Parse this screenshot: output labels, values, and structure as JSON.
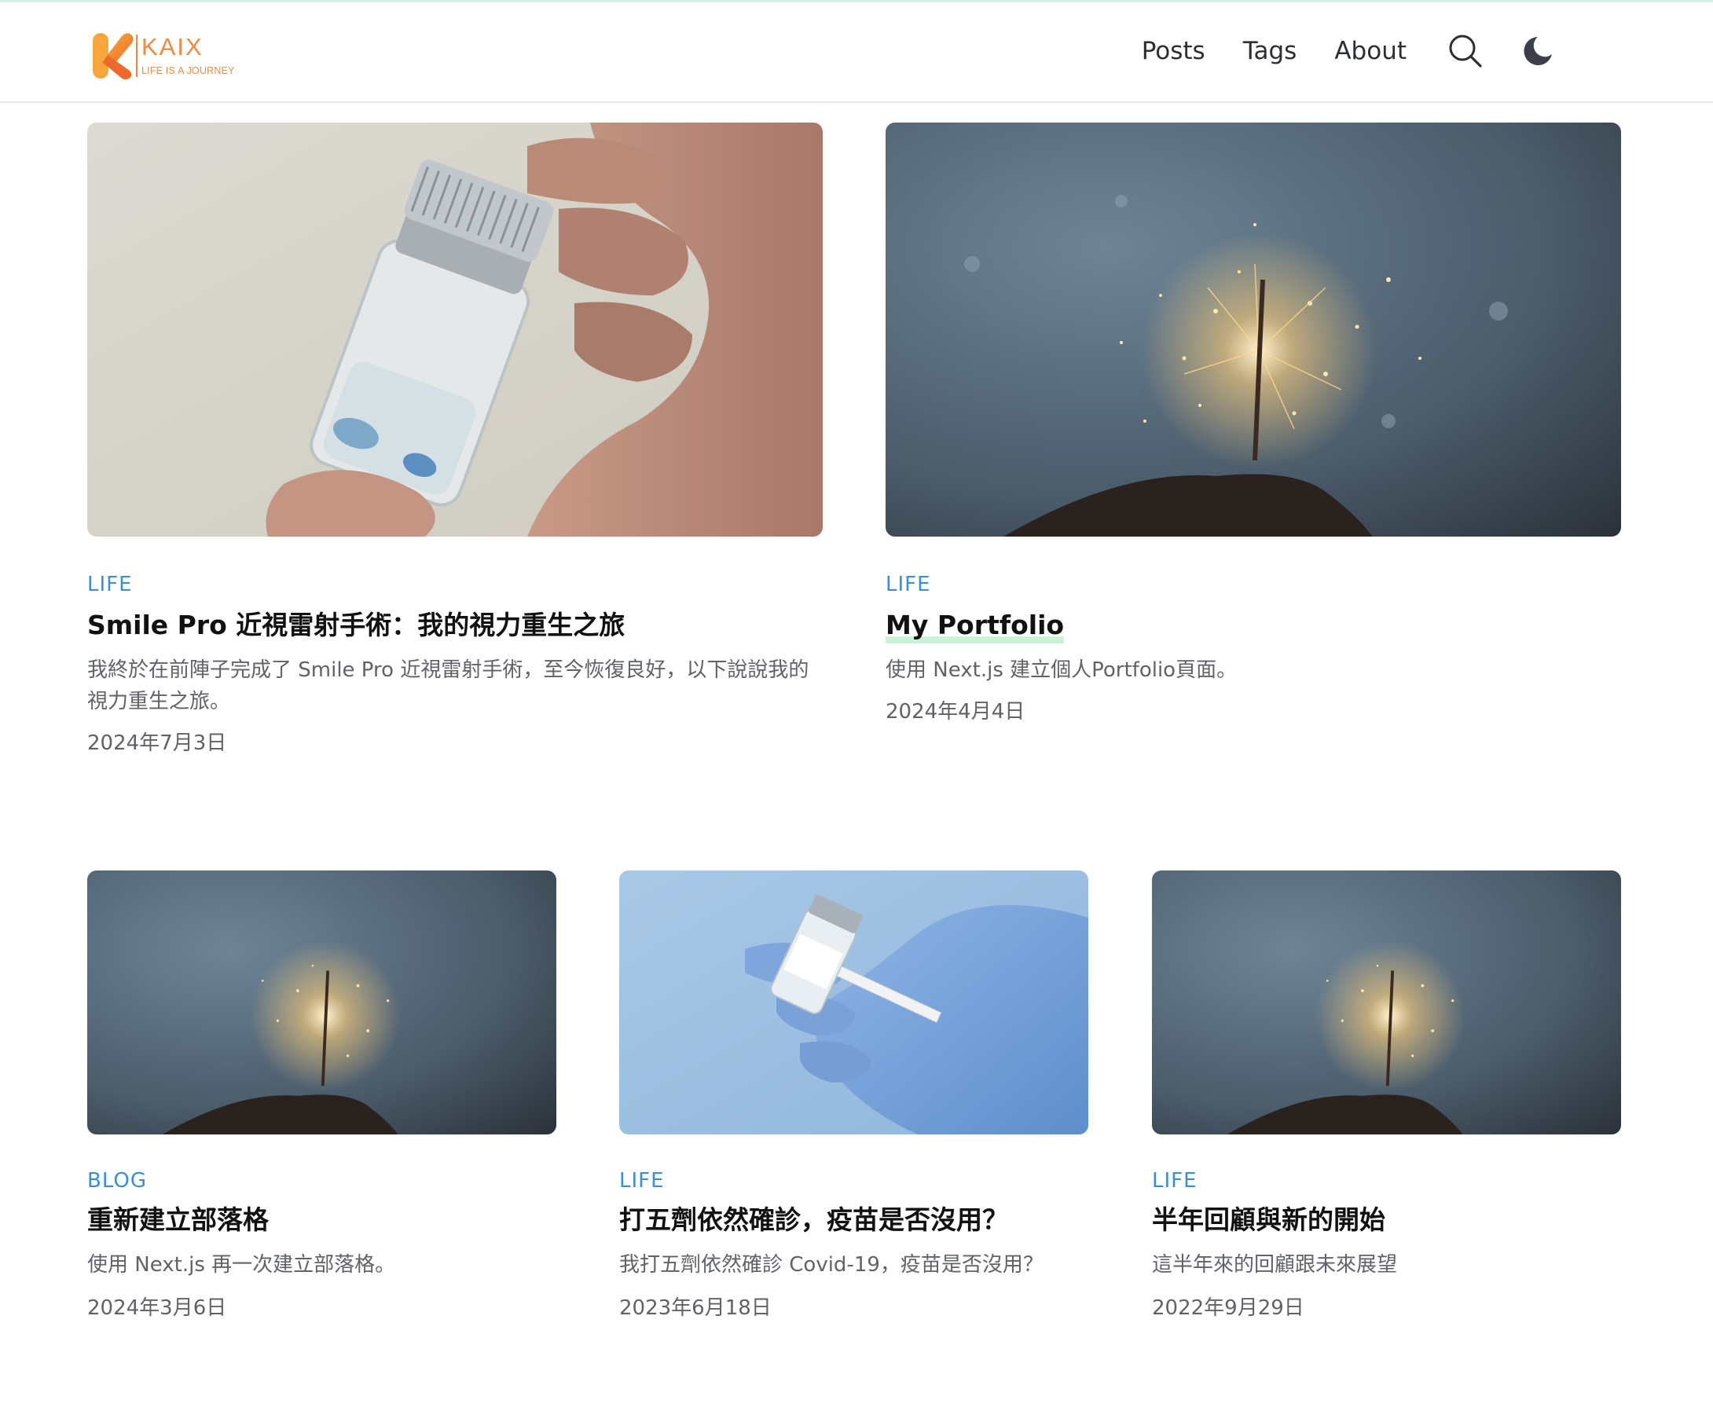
{
  "brand": {
    "name": "KAIX",
    "tagline": "LIFE IS A JOURNEY",
    "color": "#f08a3e"
  },
  "nav": {
    "posts": "Posts",
    "tags": "Tags",
    "about": "About",
    "search_icon": "search-icon",
    "theme_icon": "moon-icon"
  },
  "posts": [
    {
      "tag": "LIFE",
      "title": "Smile Pro 近視雷射手術：我的視力重生之旅",
      "desc": "我終於在前陣子完成了 Smile Pro 近視雷射手術，至今恢復良好，以下說說我的視力重生之旅。",
      "date": "2024年7月3日",
      "image": "hand holding glass vial"
    },
    {
      "tag": "LIFE",
      "title": "My Portfolio",
      "desc": "使用 Next.js 建立個人Portfolio頁面。",
      "date": "2024年4月4日",
      "image": "sparkler"
    },
    {
      "tag": "BLOG",
      "title": "重新建立部落格",
      "desc": "使用 Next.js 再一次建立部落格。",
      "date": "2024年3月6日",
      "image": "sparkler"
    },
    {
      "tag": "LIFE",
      "title": "打五劑依然確診，疫苗是否沒用？",
      "desc": "我打五劑依然確診 Covid-19，疫苗是否沒用？",
      "date": "2023年6月18日",
      "image": "gloved hand holding vaccine vial"
    },
    {
      "tag": "LIFE",
      "title": "半年回顧與新的開始",
      "desc": "這半年來的回顧跟未來展望",
      "date": "2022年9月29日",
      "image": "sparkler"
    }
  ],
  "colors": {
    "tag": "#3a8fd4",
    "meta": "#5f6368",
    "highlight": "#c9f2d6"
  }
}
